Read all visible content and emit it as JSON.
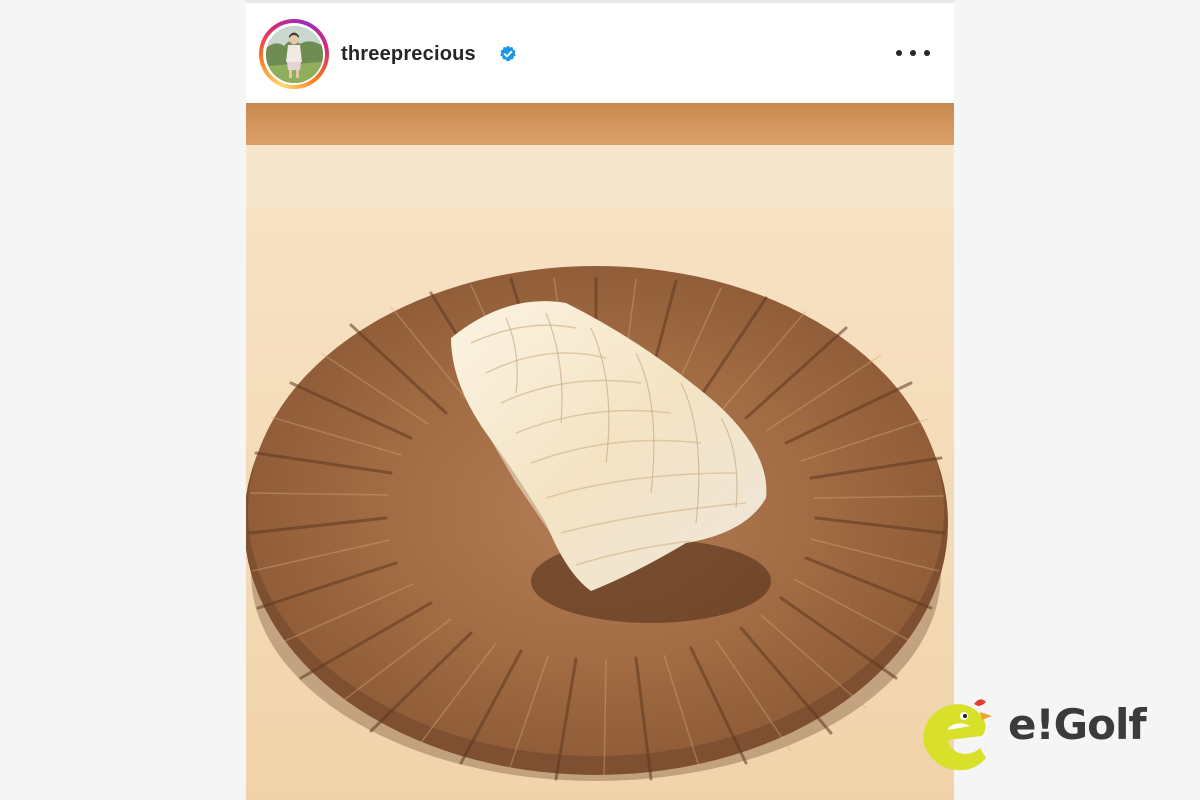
{
  "post": {
    "username": "threeprecious",
    "verified_icon": "verified-badge-icon",
    "more_icon": "more-options-icon",
    "photo_subject": "squid-nigiri-on-plate-photo",
    "colors": {
      "verified": "#1c96e8",
      "text": "#262626",
      "plate": "#a8714a",
      "counter": "#f4dcb8"
    }
  },
  "watermark": {
    "brand": "e!Golf",
    "mascot_icon": "egolf-mascot-icon"
  }
}
